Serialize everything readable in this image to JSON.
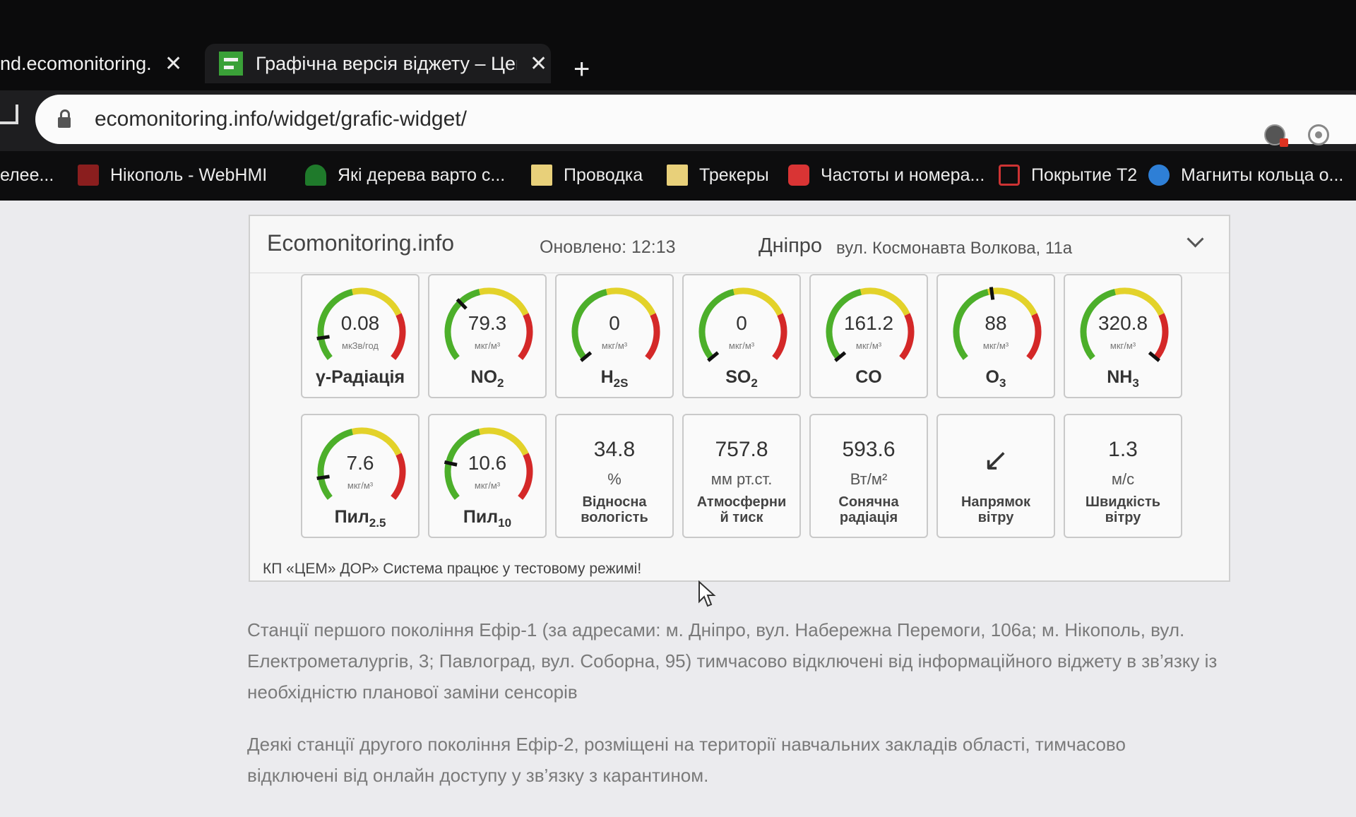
{
  "browser": {
    "tabs": [
      {
        "label": "nd.ecomonitoring.i",
        "close": "✕"
      },
      {
        "label": "Графічна версія віджету – Цент",
        "close": "✕"
      }
    ],
    "new_tab": "+",
    "url": "ecomonitoring.info/widget/grafic-widget/",
    "bookmarks": [
      {
        "label": "елее...",
        "icon": "none"
      },
      {
        "label": "Нікополь - WebHMI",
        "icon": "hmi-icon"
      },
      {
        "label": "Які дерева варто с...",
        "icon": "tree-icon"
      },
      {
        "label": "Проводка",
        "icon": "folder-icon"
      },
      {
        "label": "Трекеры",
        "icon": "folder-icon"
      },
      {
        "label": "Частоты и номера...",
        "icon": "red-app-icon"
      },
      {
        "label": "Покрытие Т2",
        "icon": "wing-icon"
      },
      {
        "label": "Магниты кольца о...",
        "icon": "blue-globe-icon"
      }
    ]
  },
  "widget": {
    "brand": "Ecomonitoring.info",
    "updated": "Оновлено: 12:13",
    "city": "Дніпро",
    "address": "вул. Космонавта Волкова, 11а",
    "footer": "КП «ЦЕМ» ДОР» Система працює у тестовому режимі!",
    "gauges": [
      {
        "value": "0.08",
        "unit": "мкЗв/год",
        "label": "γ-Радіація",
        "sub": "",
        "level": 0.12
      },
      {
        "value": "79.3",
        "unit": "мкг/м³",
        "label": "NO",
        "sub": "2",
        "level": 0.33
      },
      {
        "value": "0",
        "unit": "мкг/м³",
        "label": "H",
        "sub": "2S",
        "level": 0.0
      },
      {
        "value": "0",
        "unit": "мкг/м³",
        "label": "SO",
        "sub": "2",
        "level": 0.0
      },
      {
        "value": "161.2",
        "unit": "мкг/м³",
        "label": "CO",
        "sub": "",
        "level": 0.0
      },
      {
        "value": "88",
        "unit": "мкг/м³",
        "label": "O",
        "sub": "3",
        "level": 0.47
      },
      {
        "value": "320.8",
        "unit": "мкг/м³",
        "label": "NH",
        "sub": "3",
        "level": 1.0
      },
      {
        "value": "7.6",
        "unit": "мкг/м³",
        "label": "Пил",
        "sub": "2.5",
        "level": 0.12
      },
      {
        "value": "10.6",
        "unit": "мкг/м³",
        "label": "Пил",
        "sub": "10",
        "level": 0.2
      }
    ],
    "values": [
      {
        "value": "34.8",
        "unit": "%",
        "label1": "Відносна",
        "label2": "вологість"
      },
      {
        "value": "757.8",
        "unit": "мм рт.ст.",
        "label1": "Атмосферни",
        "label2": "й тиск"
      },
      {
        "value": "593.6",
        "unit": "Вт/м²",
        "label1": "Сонячна",
        "label2": "радіація"
      },
      {
        "value": "↙",
        "unit": "",
        "label1": "Напрямок",
        "label2": "вітру"
      },
      {
        "value": "1.3",
        "unit": "м/с",
        "label1": "Швидкість",
        "label2": "вітру"
      }
    ],
    "colors": {
      "green": "#4caf2a",
      "yellow": "#e3d22a",
      "red": "#d42828"
    }
  },
  "content": {
    "para1_line1": "Станції першого покоління Ефір-1 (за адресами: м. Дніпро, вул. Набережна Перемоги, 106а; м. Нікополь, вул.",
    "para1_line2": "Електрометалургів, 3; Павлоград, вул. Соборна, 95) тимчасово відключені від інформаційного віджету в зв’язку із",
    "para1_line3": "необхідністю планової заміни сенсорів",
    "para2_line1": "Деякі станції другого покоління Ефір-2, розміщені на території навчальних закладів області, тимчасово",
    "para2_line2": "відключені від онлайн доступу у зв’язку з карантином."
  }
}
